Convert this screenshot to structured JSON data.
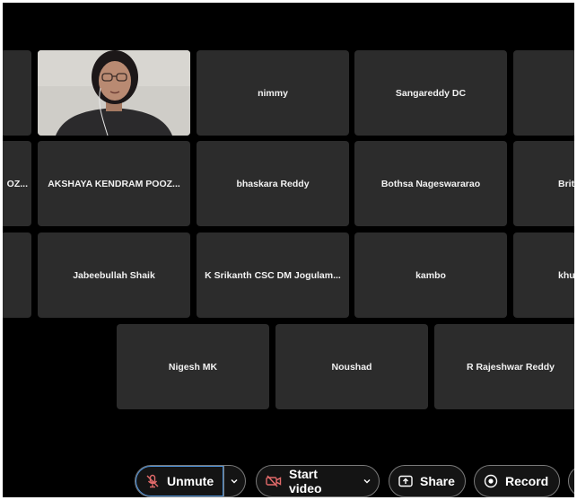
{
  "tiles": {
    "row1": [
      "",
      "nimmy",
      "Sangareddy DC",
      ""
    ],
    "row2": [
      "OZ...",
      "AKSHAYA KENDRAM POOZ...",
      "bhaskara Reddy",
      "Bothsa Nageswararao",
      "Britt"
    ],
    "row3": [
      "",
      "Jabeebullah Shaik",
      "K Srikanth CSC DM Jogulam...",
      "kambo",
      "khumc"
    ],
    "row4": [
      "Nigesh MK",
      "Noushad",
      "R Rajeshwar Reddy"
    ]
  },
  "toolbar": {
    "unmute_label": "Unmute",
    "start_video_label": "Start video",
    "share_label": "Share",
    "record_label": "Record"
  },
  "icons": {
    "unmute": "mic-off-icon",
    "video": "video-off-icon",
    "share": "share-icon",
    "record": "record-icon",
    "dropdown": "chevron-down-icon"
  },
  "colors": {
    "background": "#000000",
    "tile": "#2c2c2c",
    "focus": "#4a90d9",
    "muted_icon": "#e26a6a"
  }
}
